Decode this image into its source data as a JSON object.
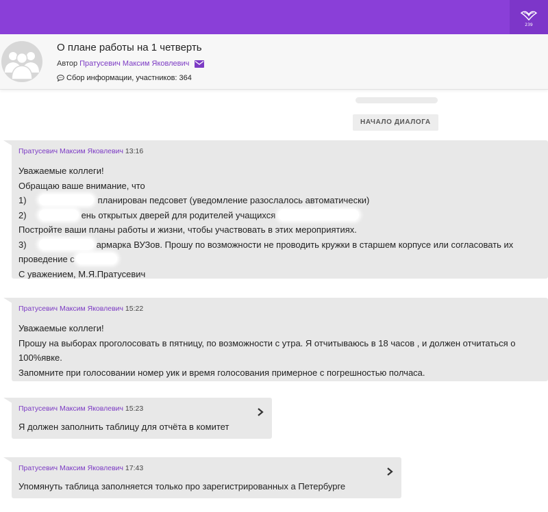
{
  "header": {
    "title": "О плане работы на 1 четверть",
    "author_prefix": "Автор",
    "author_name": "Пратусевич Максим Яковлевич",
    "info": "Сбор информации, участников: 364",
    "logo_text": "239"
  },
  "dialog_start_label": "НАЧАЛО ДИАЛОГА",
  "messages": [
    {
      "author": "Пратусевич Максим Яковлевич",
      "time": "13:16",
      "lines": {
        "l0": "Уважаемые коллеги!",
        "l1": "Обращаю ваше внимание, что",
        "l2a": "1)",
        "l2b": "планирован педсовет (уведомление разослалось автоматически)",
        "l3a": "2)",
        "l3b": "ень открытых дверей для родителей учащихся",
        "l4": "Постройте ваши планы работы и жизни, чтобы участвовать в этих мероприятиях.",
        "l5a": "3)",
        "l5b": "армарка ВУЗов. Прошу по возможности не проводить кружки в старшем корпусе или согласовать их",
        "l6": "проведение с",
        "l7": "С уважением, М.Я.Пратусевич"
      }
    },
    {
      "author": "Пратусевич Максим Яковлевич",
      "time": "15:22",
      "lines": {
        "l0": "Уважаемые коллеги!",
        "l1": "Прошу на выборах проголосовать в пятницу, по возможности с утра. Я отчитываюсь в 18 часов , и должен отчитаться о",
        "l2": "100%явке.",
        "l3": "Запомните при голосовании номер уик и время голосования примерное с погрешностью полчаса."
      }
    },
    {
      "author": "Пратусевич Максим Яковлевич",
      "time": "15:23",
      "text": "Я должен заполнить таблицу для отчёта в комитет"
    },
    {
      "author": "Пратусевич Максим Яковлевич",
      "time": "17:43",
      "text": "Упомянуть таблица заполняется только про зарегистрированных а Петербурге"
    }
  ],
  "colors": {
    "topbar": "#8a3fd8",
    "accent": "#7c3bc4",
    "bubble": "#e8e8e8"
  }
}
